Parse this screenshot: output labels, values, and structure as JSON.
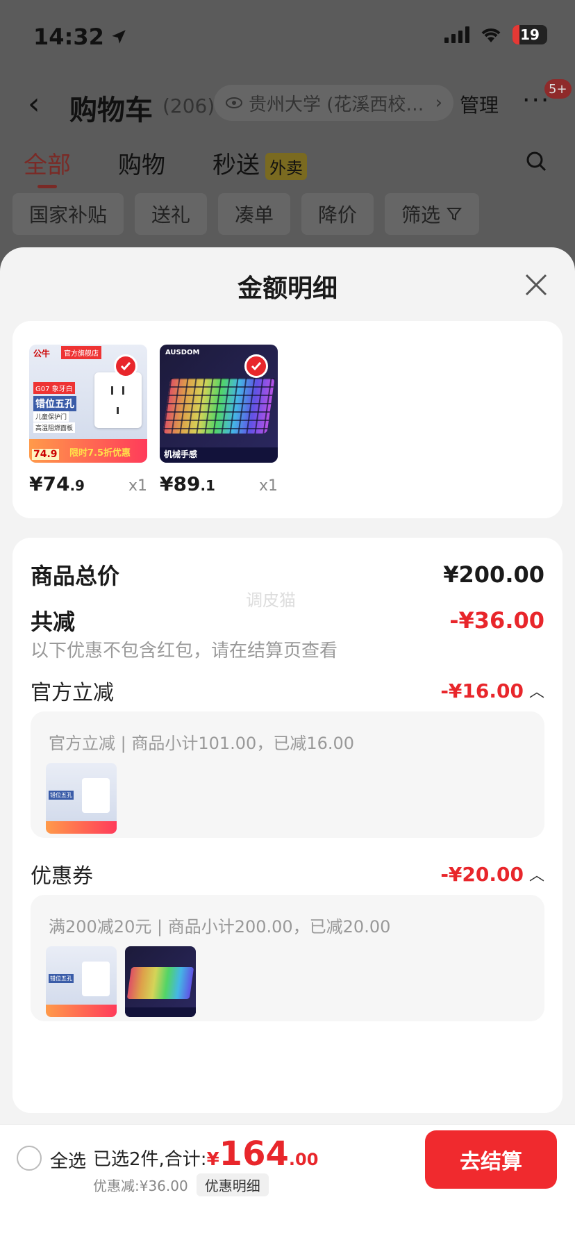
{
  "status": {
    "time": "14:32",
    "battery": "19"
  },
  "header": {
    "title": "购物车",
    "count": "(206)",
    "location": "贵州大学 (花溪西校…",
    "manage": "管理",
    "badge": "5+"
  },
  "tabs": [
    {
      "label": "全部"
    },
    {
      "label": "购物"
    },
    {
      "label": "秒送"
    }
  ],
  "tab_tag": "外卖",
  "filters": [
    "国家补贴",
    "送礼",
    "凑单",
    "降价",
    "筛选"
  ],
  "sheet": {
    "title": "金额明细",
    "products": [
      {
        "brand": "公牛",
        "store_tag": "官方旗舰店",
        "model": "G07 象牙白",
        "feature": "错位五孔",
        "sub1": "儿童保护门",
        "sub2": "高温阻燃面板",
        "promo": "限时7.5折优惠",
        "promo_price": "74.9",
        "price_int": "¥74",
        "price_dec": ".9",
        "qty": "x1"
      },
      {
        "brand": "AUSDOM",
        "feature": "机械手感",
        "price_int": "¥89",
        "price_dec": ".1",
        "qty": "x1"
      }
    ],
    "total_label": "商品总价",
    "total_value": "¥200.00",
    "watermark": "调皮猫",
    "reduce_label": "共减",
    "reduce_value": "-¥36.00",
    "reduce_note": "以下优惠不包含红包，请在结算页查看",
    "official_label": "官方立减",
    "official_value": "-¥16.00",
    "official_box": "官方立减 | 商品小计101.00，已减16.00",
    "coupon_label": "优惠券",
    "coupon_value": "-¥20.00",
    "coupon_box": "满200减20元 | 商品小计200.00，已减20.00"
  },
  "bottom": {
    "select_all": "全选",
    "summary_prefix": "已选2件,合计:",
    "yen": "¥",
    "amount_int": "164",
    "amount_dec": ".00",
    "discount": "优惠减:¥36.00",
    "detail": "优惠明细",
    "checkout": "去结算"
  },
  "colors": {
    "accent": "#e8262b",
    "checkout": "#f02a2e"
  }
}
